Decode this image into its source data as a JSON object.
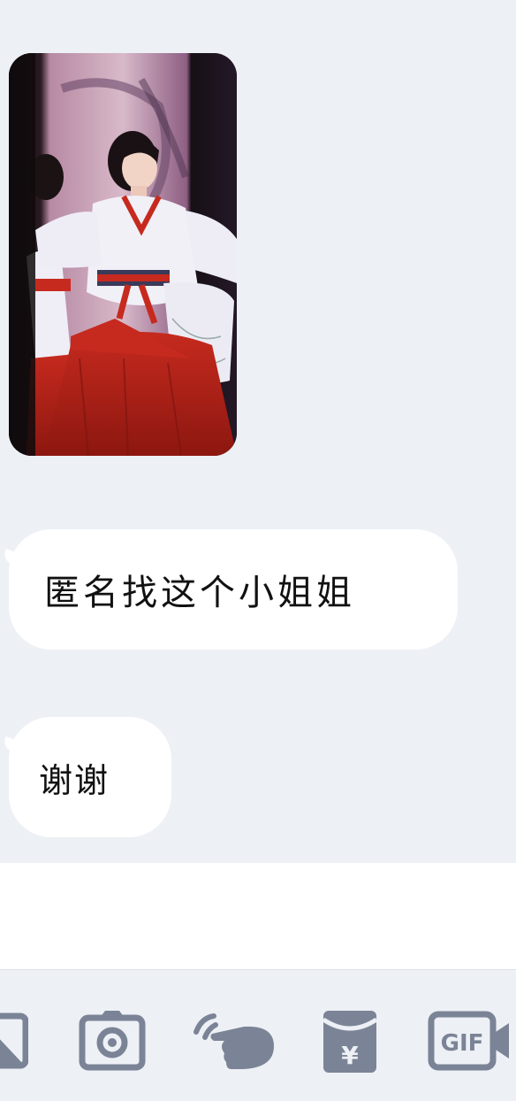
{
  "messages": [
    {
      "type": "image",
      "alt": ""
    },
    {
      "type": "text",
      "text": "匿名找这个小姐姐"
    },
    {
      "type": "text",
      "text": "谢谢"
    }
  ],
  "toolbar": {
    "icons": [
      "image-icon",
      "camera-icon",
      "poke-icon",
      "red-packet-icon",
      "gif-icon"
    ],
    "gif_label": "GIF",
    "red_packet_symbol": "¥"
  },
  "colors": {
    "background": "#edf0f5",
    "bubble": "#ffffff",
    "icon": "#7b8496"
  }
}
